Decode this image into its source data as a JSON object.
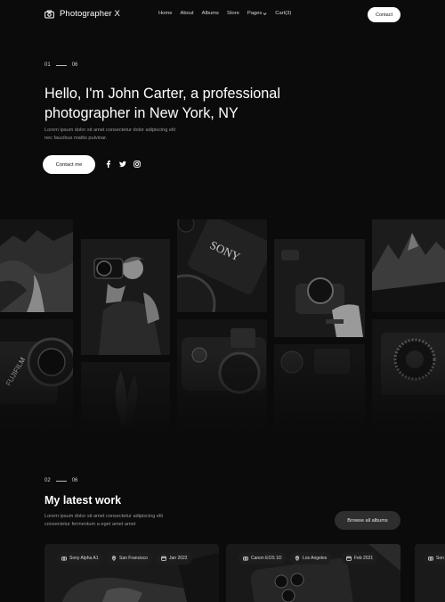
{
  "nav": {
    "brand": "Photographer X",
    "items": [
      {
        "label": "Home"
      },
      {
        "label": "About"
      },
      {
        "label": "Albums"
      },
      {
        "label": "Store"
      },
      {
        "label": "Pages"
      },
      {
        "label": "Cart(3)"
      }
    ],
    "contact_label": "Contact"
  },
  "hero": {
    "counter_current": "01",
    "counter_total": "06",
    "title": "Hello, I'm John Carter, a professional photographer in New York, NY",
    "description": "Lorem ipsum dolor sit amet consectetur dolor adipiscing elit nec faucibus mattis pulvinar.",
    "cta_label": "Contact me",
    "socials": [
      "facebook-icon",
      "twitter-icon",
      "instagram-icon"
    ]
  },
  "work": {
    "counter_current": "02",
    "counter_total": "06",
    "title": "My latest work",
    "description": "Lorem ipsum dolor sit amet consectetur adipiscing elit consectetur fermentum a eget amet amet",
    "browse_label": "Browse all albums",
    "cards": [
      {
        "camera": "Sony Alpha A1",
        "location": "San Francisco",
        "date": "Jan 2022"
      },
      {
        "camera": "Canon EOS 1D",
        "location": "Los Angeles",
        "date": "Feb 2021"
      },
      {
        "camera": "Son"
      }
    ]
  }
}
